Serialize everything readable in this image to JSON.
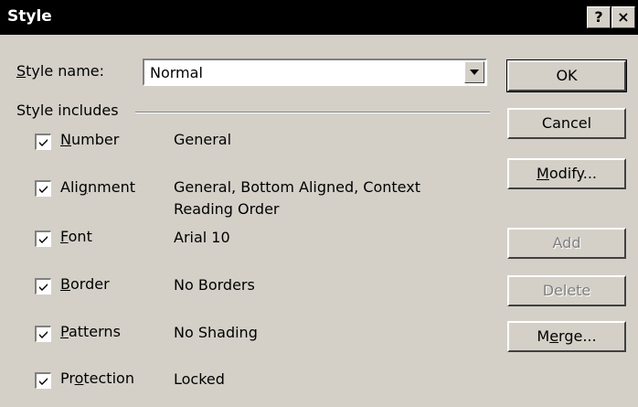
{
  "window": {
    "title": "Style",
    "help_label": "?",
    "close_label": "×"
  },
  "style_name": {
    "label_u": "S",
    "label_rest": "tyle name:",
    "value": "Normal"
  },
  "group": {
    "label": "Style includes"
  },
  "items": [
    {
      "label_before": "",
      "label_u": "N",
      "label_after": "umber",
      "checked": true,
      "value": "General"
    },
    {
      "label_before": "Ali",
      "label_u": "g",
      "label_after": "nment",
      "checked": true,
      "value": "General, Bottom Aligned, Context",
      "value2": "Reading Order"
    },
    {
      "label_before": "",
      "label_u": "F",
      "label_after": "ont",
      "checked": true,
      "value": "Arial 10"
    },
    {
      "label_before": "",
      "label_u": "B",
      "label_after": "order",
      "checked": true,
      "value": "No Borders"
    },
    {
      "label_before": "",
      "label_u": "P",
      "label_after": "atterns",
      "checked": true,
      "value": "No Shading"
    },
    {
      "label_before": "Pr",
      "label_u": "o",
      "label_after": "tection",
      "checked": true,
      "value": "Locked"
    }
  ],
  "buttons": {
    "ok": "OK",
    "cancel": "Cancel",
    "modify_u": "M",
    "modify_rest": "odify...",
    "add": "Add",
    "delete": "Delete",
    "merge_before": "M",
    "merge_u": "e",
    "merge_after": "rge..."
  }
}
